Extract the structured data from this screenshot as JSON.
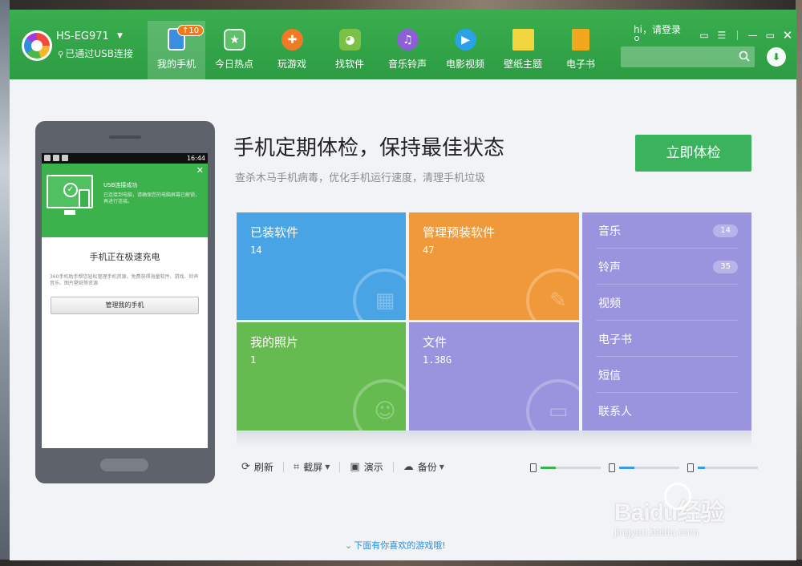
{
  "header": {
    "device_name": "HS-EG971",
    "device_status": "已通过USB连接",
    "greeting": "hi，请登录",
    "search_placeholder": "",
    "nav": [
      {
        "label": "我的手机",
        "badge": "↑10",
        "color": "#3a8fe0"
      },
      {
        "label": "今日热点",
        "badge": "",
        "color": "#5fbf6a"
      },
      {
        "label": "玩游戏",
        "badge": "",
        "color": "#f07a26"
      },
      {
        "label": "找软件",
        "badge": "",
        "color": "#7ac145"
      },
      {
        "label": "音乐铃声",
        "badge": "",
        "color": "#8d5fd6"
      },
      {
        "label": "电影视频",
        "badge": "",
        "color": "#2ba2e8"
      },
      {
        "label": "壁纸主题",
        "badge": "",
        "color": "#f2d63f"
      },
      {
        "label": "电子书",
        "badge": "",
        "color": "#f0a81e"
      }
    ]
  },
  "phone": {
    "time": "16:44",
    "usb_title": "USB连接成功",
    "usb_desc": "已连接到电脑，请确保您的电脑屏幕已解锁，再进行连接。",
    "charge_title": "手机正在极速充电",
    "charge_desc": "360手机助手帮您轻松管理手机资源，免费获得海量软件、游戏、铃声音乐、图片壁纸等资源",
    "manage_button": "管理我的手机"
  },
  "main": {
    "title": "手机定期体检，保持最佳状态",
    "subtitle": "查杀木马手机病毒，优化手机运行速度，清理手机垃圾",
    "check_button": "立即体检"
  },
  "tiles": {
    "installed": {
      "title": "已装软件",
      "value": "14"
    },
    "preinstalled": {
      "title": "管理预装软件",
      "value": "47"
    },
    "photos": {
      "title": "我的照片",
      "value": "1"
    },
    "files": {
      "title": "文件",
      "value": "1.38G"
    }
  },
  "side_list": [
    {
      "label": "音乐",
      "count": "14"
    },
    {
      "label": "铃声",
      "count": "35"
    },
    {
      "label": "视频",
      "count": ""
    },
    {
      "label": "电子书",
      "count": ""
    },
    {
      "label": "短信",
      "count": ""
    },
    {
      "label": "联系人",
      "count": ""
    }
  ],
  "toolbar": {
    "refresh": "刷新",
    "screenshot": "截屏",
    "present": "演示",
    "backup": "备份"
  },
  "storage": [
    {
      "kind": "phone",
      "used_fraction": 0.25,
      "color": "#3bb24c"
    },
    {
      "kind": "sd-card",
      "used_fraction": 0.25,
      "color": "#3a9be4"
    },
    {
      "kind": "sd-card",
      "used_fraction": 0.12,
      "color": "#3a9be4"
    }
  ],
  "bottom_tip": "下面有你喜欢的游戏哦!",
  "watermark": {
    "main": "Baidu经验",
    "sub": "jingyan.baidu.com"
  }
}
